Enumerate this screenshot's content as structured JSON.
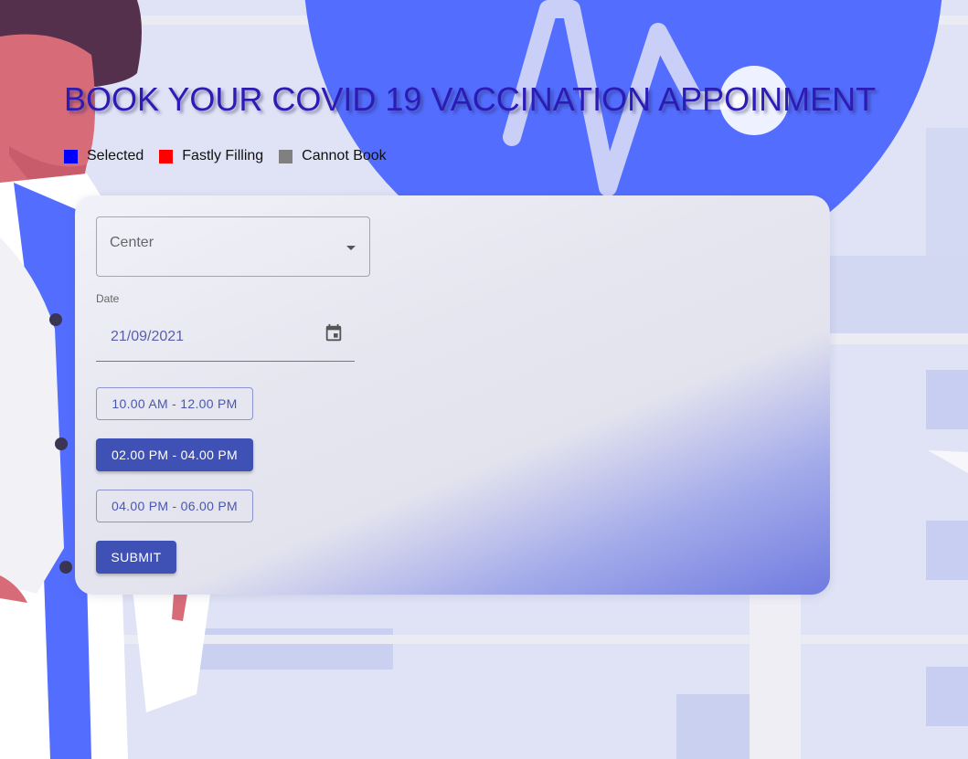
{
  "title": "BOOK YOUR COVID 19 VACCINATION APPOINMENT",
  "legend": [
    {
      "label": "Selected",
      "color": "#0000ff"
    },
    {
      "label": "Fastly Filling",
      "color": "#ff0000"
    },
    {
      "label": "Cannot Book",
      "color": "#808080"
    }
  ],
  "form": {
    "center_label": "Center",
    "date_label": "Date",
    "date_value": "21/09/2021",
    "slots": [
      {
        "label": "10.00 AM - 12.00 PM",
        "selected": false
      },
      {
        "label": "02.00 PM - 04.00 PM",
        "selected": true
      },
      {
        "label": "04.00 PM - 06.00 PM",
        "selected": false
      }
    ],
    "submit_label": "SUBMIT"
  },
  "colors": {
    "accent": "#3f51b5",
    "title": "#2c1bb5",
    "background_blue": "#536dfe"
  },
  "icons": {
    "dropdown": "chevron-down-icon",
    "date": "calendar-icon"
  }
}
